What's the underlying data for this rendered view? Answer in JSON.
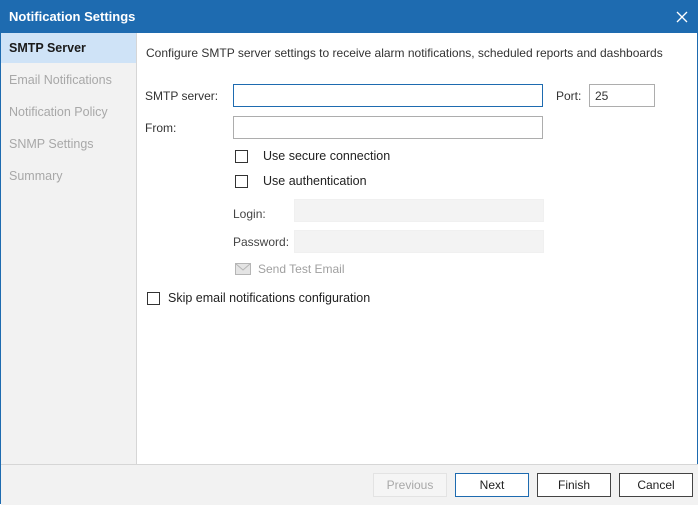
{
  "window": {
    "title": "Notification Settings",
    "close_icon": "close-icon"
  },
  "colors": {
    "accent": "#1e6bb0",
    "sidebar_active_bg": "#cfe3f7",
    "disabled_text": "#a8a8a8"
  },
  "sidebar": {
    "items": [
      {
        "label": "SMTP Server",
        "active": true
      },
      {
        "label": "Email Notifications",
        "active": false
      },
      {
        "label": "Notification Policy",
        "active": false
      },
      {
        "label": "SNMP Settings",
        "active": false
      },
      {
        "label": "Summary",
        "active": false
      }
    ]
  },
  "main": {
    "subtitle": "Configure SMTP server settings to receive alarm notifications, scheduled reports and dashboards",
    "smtp_server": {
      "label": "SMTP server:",
      "value": ""
    },
    "port": {
      "label": "Port:",
      "value": "25"
    },
    "from": {
      "label": "From:",
      "value": ""
    },
    "secure_connection": {
      "label": "Use secure connection",
      "checked": false
    },
    "use_authentication": {
      "label": "Use authentication",
      "checked": false
    },
    "login": {
      "label": "Login:",
      "value": ""
    },
    "password": {
      "label": "Password:",
      "value": ""
    },
    "send_test_email": {
      "label": "Send Test Email",
      "icon": "envelope-icon",
      "enabled": false
    },
    "skip_email": {
      "label": "Skip email notifications configuration",
      "checked": false
    }
  },
  "footer": {
    "previous": "Previous",
    "next": "Next",
    "finish": "Finish",
    "cancel": "Cancel"
  }
}
